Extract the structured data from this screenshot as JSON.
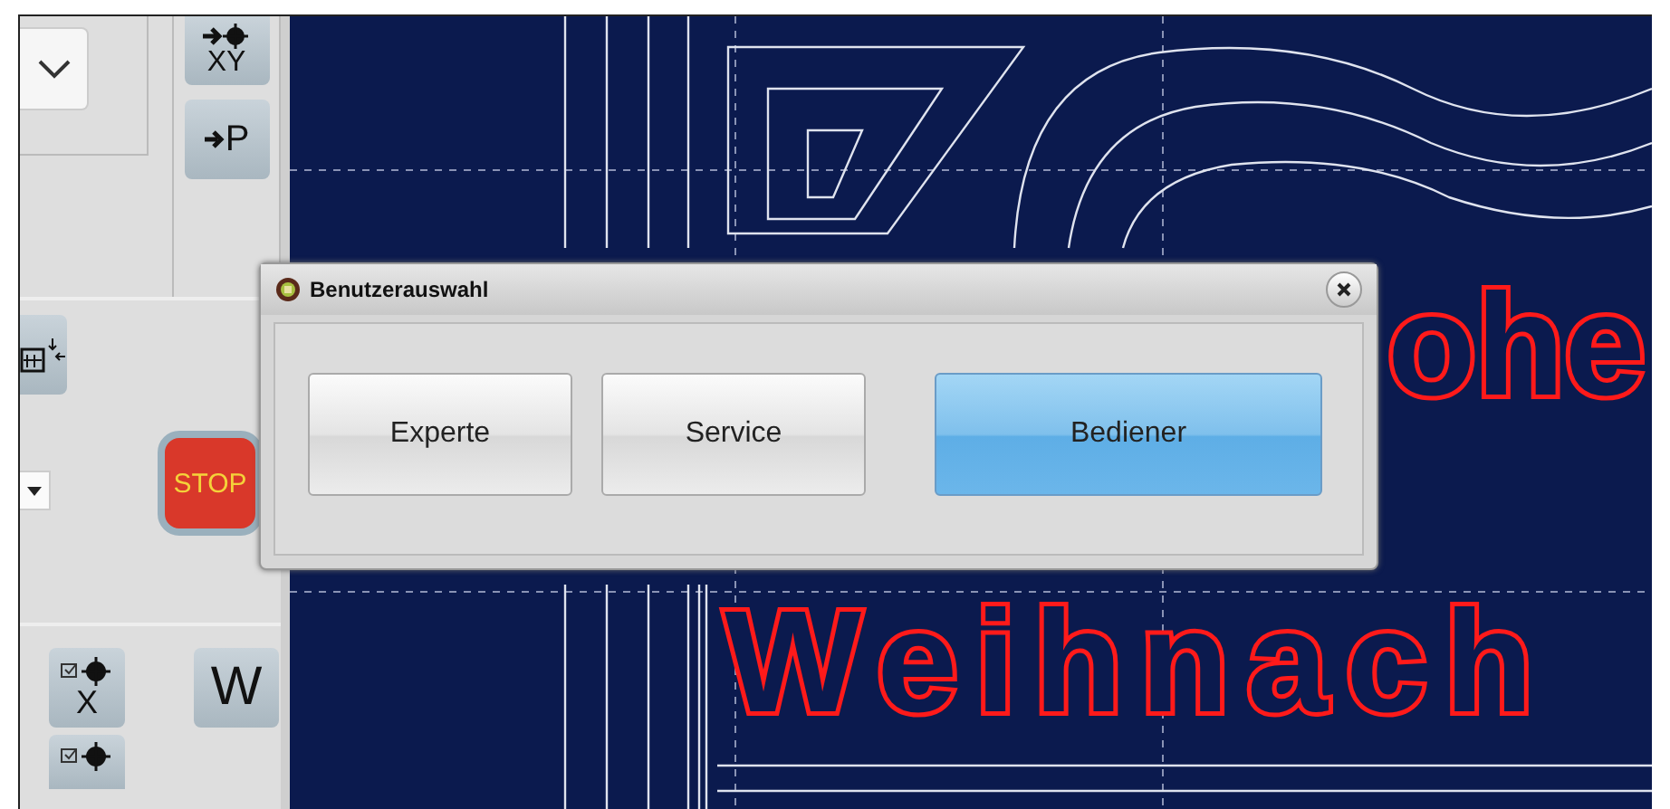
{
  "left_panel": {
    "top_buttons": [
      {
        "label": "XY",
        "kind": "move"
      },
      {
        "label": "P",
        "kind": "move"
      }
    ],
    "stop_button": {
      "label": "STOP"
    },
    "bottom_buttons": [
      {
        "label": "X",
        "kind": "zero"
      },
      {
        "label": "W",
        "kind": "plain"
      }
    ]
  },
  "canvas": {
    "texts": [
      "ohe",
      "Weihnach"
    ]
  },
  "dialog": {
    "title": "Benutzerauswahl",
    "buttons": [
      {
        "label": "Experte",
        "selected": false
      },
      {
        "label": "Service",
        "selected": false
      },
      {
        "label": "Bediener",
        "selected": true
      }
    ]
  }
}
